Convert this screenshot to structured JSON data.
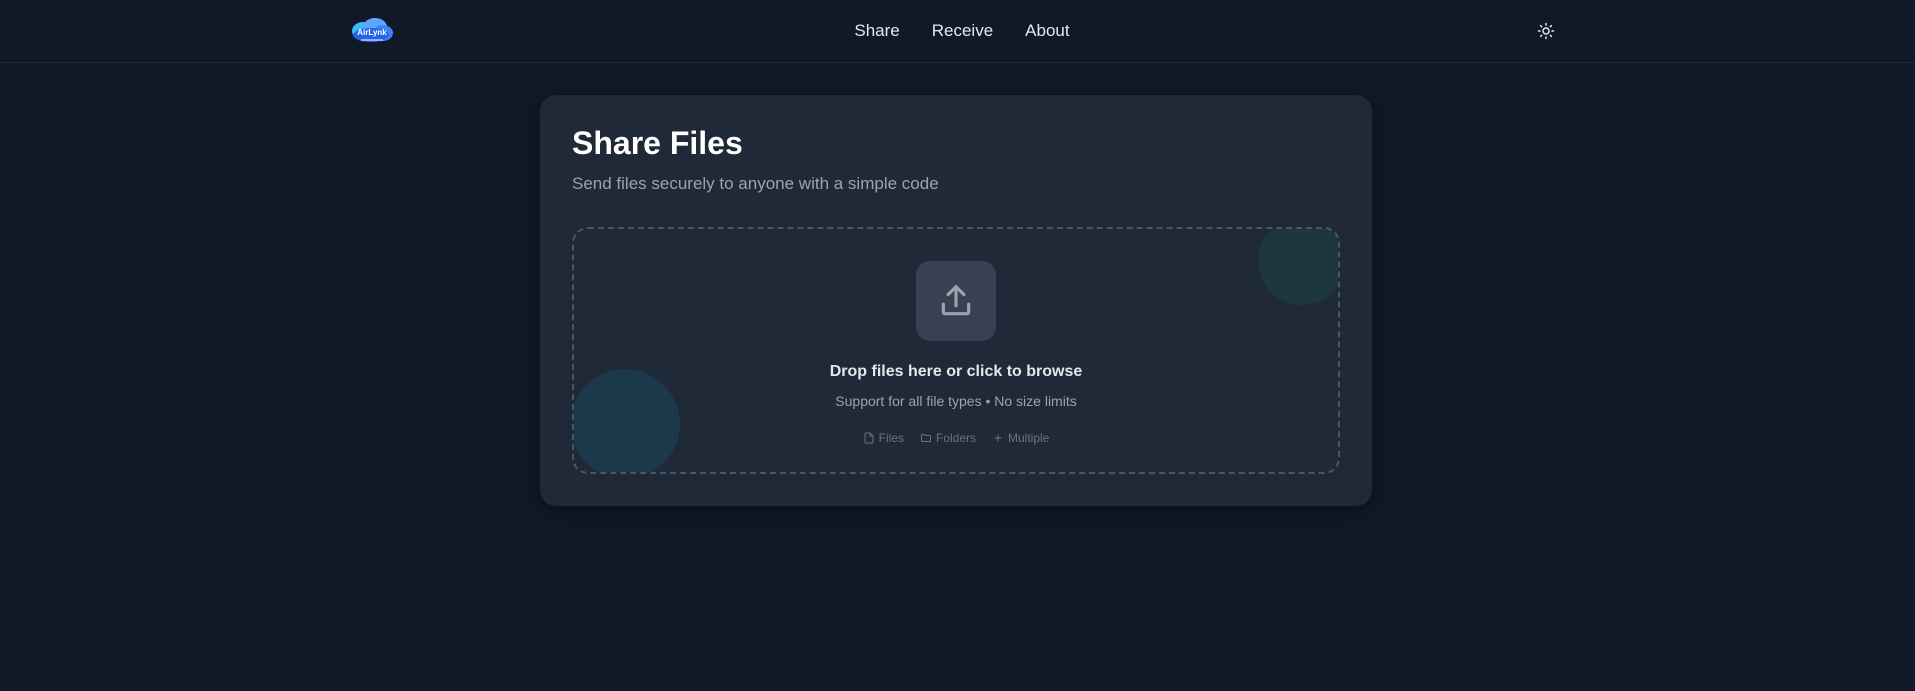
{
  "header": {
    "logo_text": "AirLynk",
    "nav": [
      {
        "label": "Share"
      },
      {
        "label": "Receive"
      },
      {
        "label": "About"
      }
    ],
    "theme_toggle_icon": "sun-icon"
  },
  "card": {
    "title": "Share Files",
    "subtitle": "Send files securely to anyone with a simple code",
    "dropzone": {
      "icon": "upload-icon",
      "title": "Drop files here or click to browse",
      "subtitle": "Support for all file types • No size limits",
      "types": [
        {
          "icon": "file-icon",
          "label": "Files"
        },
        {
          "icon": "folder-icon",
          "label": "Folders"
        },
        {
          "icon": "plus-icon",
          "label": "Multiple"
        }
      ]
    }
  },
  "colors": {
    "background": "#111827",
    "card": "#1f2937",
    "text": "#e5e7eb",
    "muted": "#9ca3af"
  }
}
